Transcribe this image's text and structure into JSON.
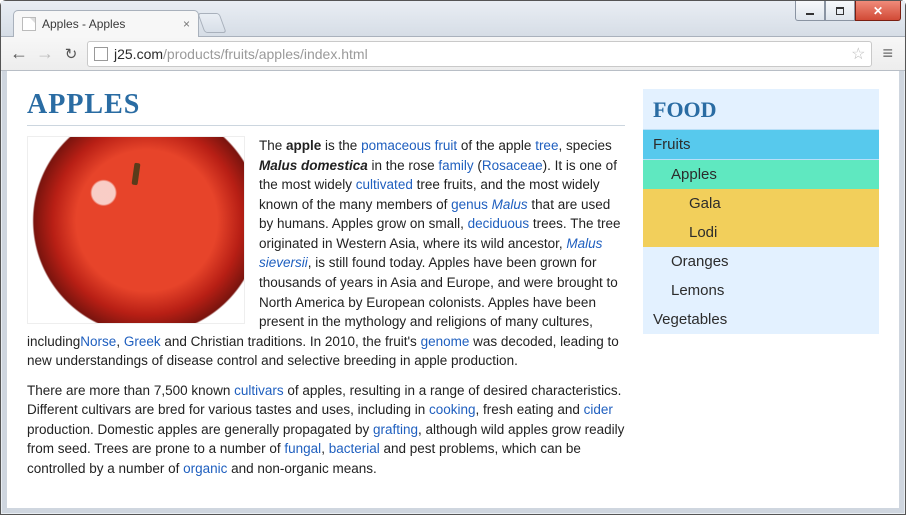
{
  "window": {
    "tab_title": "Apples - Apples"
  },
  "toolbar": {
    "url_host": "j25.com",
    "url_path": "/products/fruits/apples/index.html"
  },
  "page": {
    "title": "APPLES",
    "para1_parts": {
      "t1": "The ",
      "b1": "apple",
      "t2": " is the ",
      "l1": "pomaceous fruit",
      "t3": " of the apple ",
      "l2": "tree",
      "t4": ", species ",
      "bi1": "Malus domestica",
      "t5": " in the rose ",
      "l3": "family",
      "t6": " (",
      "l4": "Rosaceae",
      "t7": "). It is one of the most widely ",
      "l5": "cultivated",
      "t8": " tree fruits, and the most widely known of the many members of ",
      "l6": "genus",
      "t9": " ",
      "il1": "Malus",
      "t10": " that are used by humans. Apples grow on small, ",
      "l7": "deciduous",
      "t11": " trees. The tree originated in Western Asia, where its wild ancestor, ",
      "il2": "Malus sieversii",
      "t12": ", is still found today. Apples have been grown for thousands of years in Asia and Europe, and were brought to North America by European colonists. Apples have been present in the mythology and religions of many cultures, including",
      "l8": "Norse",
      "t13": ", ",
      "l9": "Greek",
      "t14": " and Christian traditions. In 2010, the fruit's ",
      "l10": "genome",
      "t15": " was decoded, leading to new understandings of disease control and selective breeding in apple production."
    },
    "para2_parts": {
      "t1": "There are more than 7,500 known ",
      "l1": "cultivars",
      "t2": " of apples, resulting in a range of desired characteristics. Different cultivars are bred for various tastes and uses, including in ",
      "l2": "cooking",
      "t3": ", fresh eating and ",
      "l3": "cider",
      "t4": " production. Domestic apples are generally propagated by ",
      "l4": "grafting",
      "t5": ", although wild apples grow readily from seed. Trees are prone to a number of ",
      "l5": "fungal",
      "t6": ", ",
      "l6": "bacterial",
      "t7": " and pest problems, which can be controlled by a number of ",
      "l7": "organic",
      "t8": " and non-organic means."
    }
  },
  "sidebar": {
    "heading": "FOOD",
    "items": [
      {
        "label": "Fruits",
        "level": 1,
        "active": false
      },
      {
        "label": "Apples",
        "level": 2,
        "active": true
      },
      {
        "label": "Gala",
        "level": 3,
        "active": false
      },
      {
        "label": "Lodi",
        "level": 3,
        "active": false
      },
      {
        "label": "Oranges",
        "level": 2,
        "active": false
      },
      {
        "label": "Lemons",
        "level": 2,
        "active": false
      },
      {
        "label": "Vegetables",
        "level": 1,
        "active": false,
        "plain": true
      }
    ]
  }
}
